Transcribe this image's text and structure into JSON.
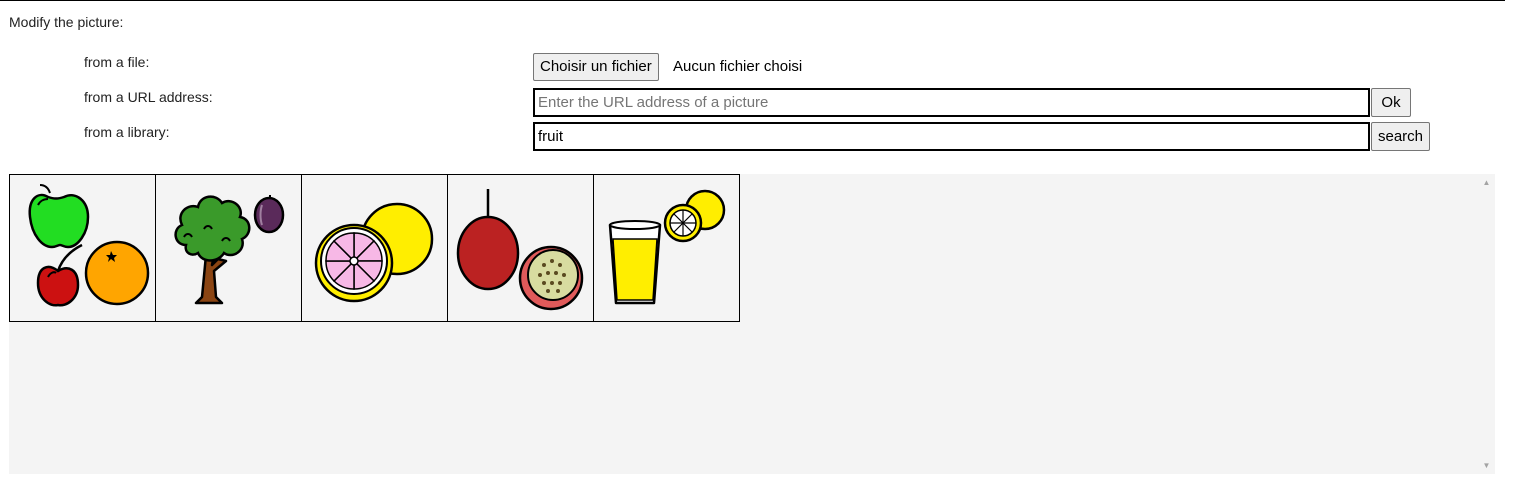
{
  "form": {
    "heading": "Modify the picture:",
    "file": {
      "label": "from a file:",
      "button_label": "Choisir un fichier",
      "status": "Aucun fichier choisi"
    },
    "url": {
      "label": "from a URL address:",
      "placeholder": "Enter the URL address of a picture",
      "value": "",
      "button_label": "Ok"
    },
    "library": {
      "label": "from a library:",
      "value": "fruit",
      "button_label": "search"
    }
  },
  "gallery": {
    "tiles": [
      {
        "icon": "fruits-apple-cherry-orange-icon"
      },
      {
        "icon": "plum-tree-icon"
      },
      {
        "icon": "grapefruit-icon"
      },
      {
        "icon": "passion-fruit-icon"
      },
      {
        "icon": "lemon-juice-icon"
      }
    ]
  },
  "colors": {
    "apple_green": "#22dd22",
    "cherry_red": "#cc1111",
    "orange": "#ffa500",
    "tree_green": "#3a9a2a",
    "trunk_brown": "#8b4513",
    "plum_purple": "#5a2a5a",
    "lemon_yellow": "#ffee00",
    "grapefruit_pink": "#f7b8e6",
    "passion_red": "#bb2222",
    "gallery_bg": "#f4f4f4"
  }
}
